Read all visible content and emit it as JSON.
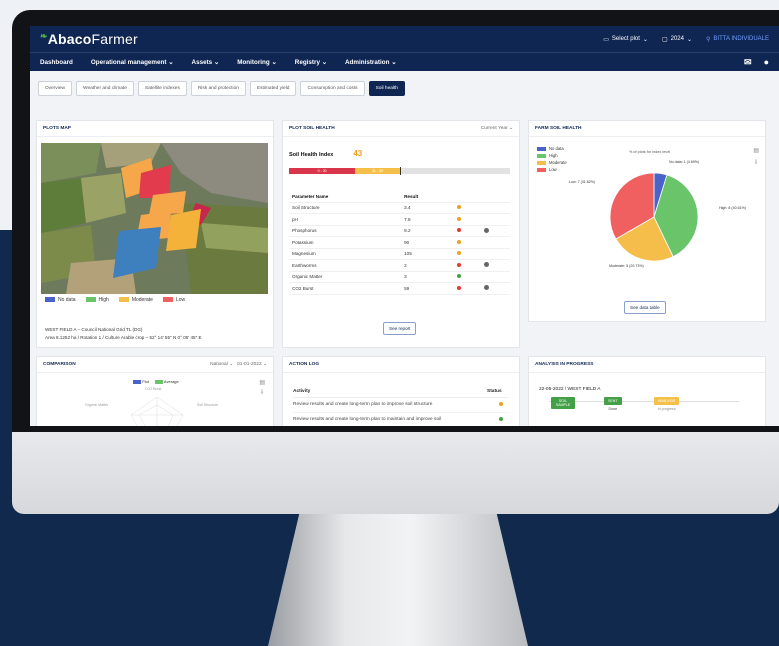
{
  "app": {
    "brand_bold": "Abaco",
    "brand_light": "Farmer"
  },
  "topbar": {
    "select_plot": "Select plot",
    "year": "2024",
    "user": "BITTA INDIVIDUALE"
  },
  "nav": {
    "items": [
      "Dashboard",
      "Operational management",
      "Assets",
      "Monitoring",
      "Registry",
      "Administration"
    ],
    "chevron": "⌄"
  },
  "tabs": [
    "Overview",
    "Weather and climate",
    "Satellite indexes",
    "Risk and protection",
    "Estimated yield",
    "Consumption and costs",
    "Soil health"
  ],
  "plots_map": {
    "title": "PLOTS MAP",
    "legend": [
      {
        "label": "No data",
        "color": "#4a63c8"
      },
      {
        "label": "High",
        "color": "#6ac46a"
      },
      {
        "label": "Moderate",
        "color": "#f5be4a"
      },
      {
        "label": "Low",
        "color": "#f06060"
      }
    ],
    "info_line1": "WEST FIELD A – Council National Grid TL (DG)",
    "info_line2": "Area 8.1252 ha / Rotation 1 / Culture Arable crop – 52° 14' 55\" N 0° 05' 45\" E"
  },
  "plot_soil_health": {
    "title": "PLOT SOIL HEALTH",
    "period": "Current Year ⌄",
    "index_label": "Soil Health Index",
    "index_value": "43",
    "index_fraction": 0.43,
    "bar_segments": [
      {
        "label": "0 - 30",
        "color": "#d9364b",
        "weight": 30
      },
      {
        "label": "31 - 60",
        "color": "#f5c04a",
        "weight": 20
      },
      {
        "label": "",
        "color": "#dddddd",
        "weight": 50
      }
    ],
    "col_param": "Parameter Name",
    "col_result": "Result",
    "rows": [
      {
        "name": "Soil Structure",
        "result": "3.4",
        "status": "#f0a020",
        "info": false
      },
      {
        "name": "pH",
        "result": "7.8",
        "status": "#f0a020",
        "info": false
      },
      {
        "name": "Phosphorus",
        "result": "9.2",
        "status": "#e53935",
        "info": true
      },
      {
        "name": "Potassium",
        "result": "90",
        "status": "#f0a020",
        "info": false
      },
      {
        "name": "Magnesium",
        "result": "105",
        "status": "#f0a020",
        "info": false
      },
      {
        "name": "Earthworms",
        "result": "2",
        "status": "#e53935",
        "info": true
      },
      {
        "name": "Organic Matter",
        "result": "3",
        "status": "#43a047",
        "info": false
      },
      {
        "name": "CO2 Burst",
        "result": "59",
        "status": "#e53935",
        "info": true
      }
    ],
    "see_report": "See report"
  },
  "farm_soil_health": {
    "title": "FARM SOIL HEALTH",
    "chart_title": "% of plots for index level",
    "legend": [
      {
        "label": "No data",
        "color": "#4a63c8"
      },
      {
        "label": "High",
        "color": "#6ac46a"
      },
      {
        "label": "Moderate",
        "color": "#f5be4a"
      },
      {
        "label": "Low",
        "color": "#f06060"
      }
    ],
    "see_data_table": "See data table"
  },
  "chart_data": {
    "type": "pie",
    "title": "% of plots for index level",
    "categories": [
      "No data",
      "High",
      "Moderate",
      "Low"
    ],
    "values": [
      1,
      8,
      5,
      7
    ],
    "labels": [
      "No data: 1 (4.69%)",
      "High: 8 (40.61%)",
      "Moderate: 5 (20.73%)",
      "Low: 7 (31.82%)"
    ],
    "colors": [
      "#4a63c8",
      "#6ac46a",
      "#f5be4a",
      "#f06060"
    ]
  },
  "comparison": {
    "title": "COMPARISON",
    "filter": "National ⌄",
    "date": "01-01-2022 ⌄",
    "legend": [
      "Plot",
      "Average"
    ],
    "axis1": "Organic Matter",
    "axis2": "Soil Structure",
    "axis3": "CO2 Burst"
  },
  "action_log": {
    "title": "ACTION LOG",
    "col_activity": "Activity",
    "col_status": "Status",
    "rows": [
      {
        "text": "Review results and create long-term plan to improve soil structure",
        "status": "#f0a020"
      },
      {
        "text": "Review results and create long-term plan to maintain and improve soil",
        "status": "#43a047"
      }
    ]
  },
  "analysis": {
    "title": "ANALYSIS IN PROGRESS",
    "date_field": "22-05-2022 / WEST FIELD A",
    "steps": [
      {
        "label": "SOIL SAMPLE",
        "color": "#43a047",
        "sub": ""
      },
      {
        "label": "SENT",
        "color": "#43a047",
        "sub": "Done"
      },
      {
        "label": "ANALYSIS",
        "color": "#f5c04a",
        "sub": "In progress"
      }
    ]
  }
}
